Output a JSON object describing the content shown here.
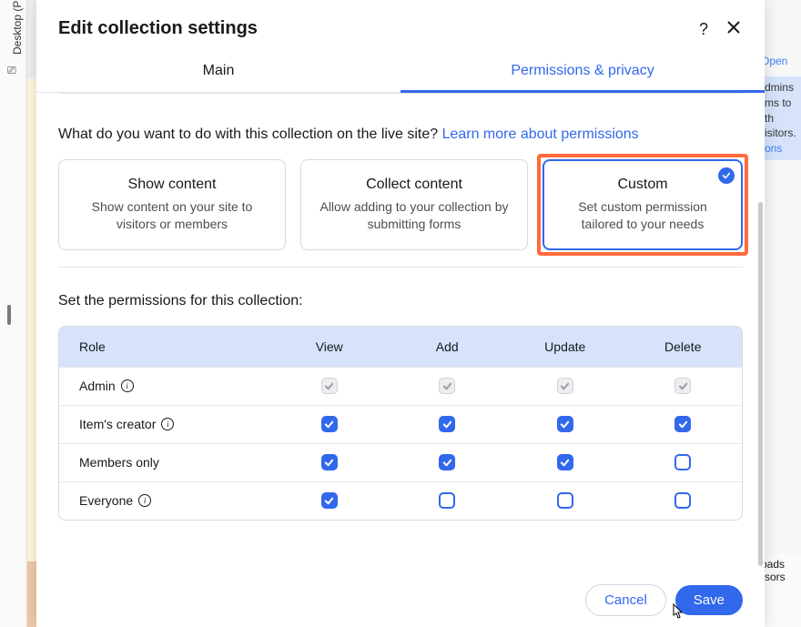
{
  "background": {
    "left_tab": "Desktop (Prima",
    "right_link": "Open",
    "right_block": "dmins ms to th isitors.",
    "right_block_link": "ons",
    "bottom1": "oads",
    "bottom2": "rsors"
  },
  "modal": {
    "title": "Edit collection settings",
    "tabs": {
      "main": "Main",
      "permissions": "Permissions & privacy"
    },
    "prompt_text": "What do you want to do with this collection on the live site? ",
    "prompt_link": "Learn more about permissions",
    "cards": {
      "show": {
        "title": "Show content",
        "desc": "Show content on your site to visitors or members"
      },
      "collect": {
        "title": "Collect content",
        "desc": "Allow adding to your collection by submitting forms"
      },
      "custom": {
        "title": "Custom",
        "desc": "Set custom permission tailored to your needs"
      }
    },
    "section_label": "Set the permissions for this collection:",
    "table": {
      "headers": {
        "role": "Role",
        "view": "View",
        "add": "Add",
        "update": "Update",
        "delete": "Delete"
      },
      "rows": [
        {
          "role": "Admin",
          "info": true,
          "view": "locked",
          "add": "locked",
          "update": "locked",
          "delete": "locked"
        },
        {
          "role": "Item's creator",
          "info": true,
          "view": "checked",
          "add": "checked",
          "update": "checked",
          "delete": "checked"
        },
        {
          "role": "Members only",
          "info": false,
          "view": "checked",
          "add": "checked",
          "update": "checked",
          "delete": "unchecked"
        },
        {
          "role": "Everyone",
          "info": true,
          "view": "checked",
          "add": "unchecked",
          "update": "unchecked",
          "delete": "unchecked"
        }
      ]
    },
    "buttons": {
      "cancel": "Cancel",
      "save": "Save"
    }
  }
}
